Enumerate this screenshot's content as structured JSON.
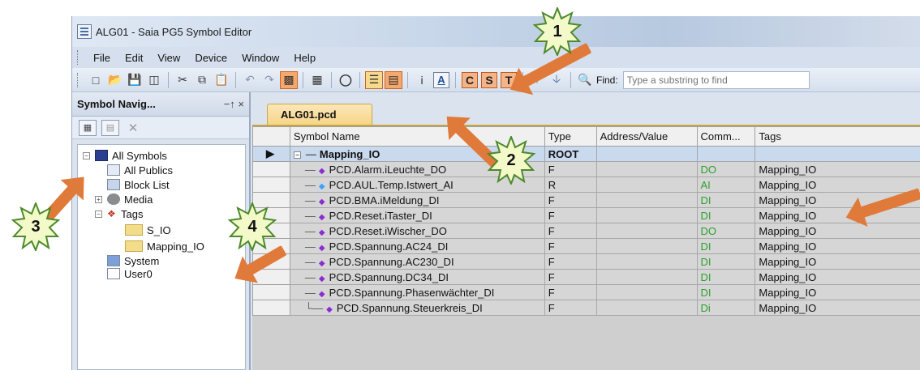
{
  "window": {
    "title": "ALG01 - Saia PG5 Symbol Editor",
    "menu": [
      "File",
      "Edit",
      "View",
      "Device",
      "Window",
      "Help"
    ]
  },
  "toolbar": {
    "find_label": "Find:",
    "find_placeholder": "Type a substring to find",
    "cst_buttons": [
      "C",
      "S",
      "T"
    ],
    "a_button": "A"
  },
  "nav": {
    "title": "Symbol Navig...",
    "pin": "−↑ ×",
    "tree": [
      {
        "label": "All Symbols",
        "icon": "pcd-icon"
      },
      {
        "label": "All Publics",
        "icon": "publics-icon"
      },
      {
        "label": "Block List",
        "icon": "block-list-icon"
      },
      {
        "label": "Media",
        "icon": "media-icon"
      },
      {
        "label": "Tags",
        "icon": "tag-icon"
      },
      {
        "label": "S_IO",
        "icon": "folder-icon"
      },
      {
        "label": "Mapping_IO",
        "icon": "folder-icon"
      },
      {
        "label": "System",
        "icon": "system-icon"
      },
      {
        "label": "User0",
        "icon": "user-icon"
      }
    ]
  },
  "doc": {
    "tab": "ALG01.pcd",
    "columns": [
      "Symbol Name",
      "Type",
      "Address/Value",
      "Comm...",
      "Tags"
    ],
    "root": {
      "name": "Mapping_IO",
      "type": "ROOT"
    },
    "rows": [
      {
        "name": "PCD.Alarm.iLeuchte_DO",
        "type": "F",
        "addr": "",
        "comm": "DO",
        "tags": "Mapping_IO"
      },
      {
        "name": "PCD.AUL.Temp.Istwert_AI",
        "type": "R",
        "addr": "",
        "comm": "AI",
        "tags": "Mapping_IO"
      },
      {
        "name": "PCD.BMA.iMeldung_DI",
        "type": "F",
        "addr": "",
        "comm": "DI",
        "tags": "Mapping_IO"
      },
      {
        "name": "PCD.Reset.iTaster_DI",
        "type": "F",
        "addr": "",
        "comm": "DI",
        "tags": "Mapping_IO"
      },
      {
        "name": "PCD.Reset.iWischer_DO",
        "type": "F",
        "addr": "",
        "comm": "DO",
        "tags": "Mapping_IO"
      },
      {
        "name": "PCD.Spannung.AC24_DI",
        "type": "F",
        "addr": "",
        "comm": "DI",
        "tags": "Mapping_IO"
      },
      {
        "name": "PCD.Spannung.AC230_DI",
        "type": "F",
        "addr": "",
        "comm": "DI",
        "tags": "Mapping_IO"
      },
      {
        "name": "PCD.Spannung.DC34_DI",
        "type": "F",
        "addr": "",
        "comm": "DI",
        "tags": "Mapping_IO"
      },
      {
        "name": "PCD.Spannung.Phasenwächter_DI",
        "type": "F",
        "addr": "",
        "comm": "DI",
        "tags": "Mapping_IO"
      },
      {
        "name": "PCD.Spannung.Steuerkreis_DI",
        "type": "F",
        "addr": "",
        "comm": "Di",
        "tags": "Mapping_IO"
      }
    ]
  },
  "annotations": {
    "badges": [
      "1",
      "2",
      "3",
      "4"
    ],
    "color": "#e07a3a"
  }
}
